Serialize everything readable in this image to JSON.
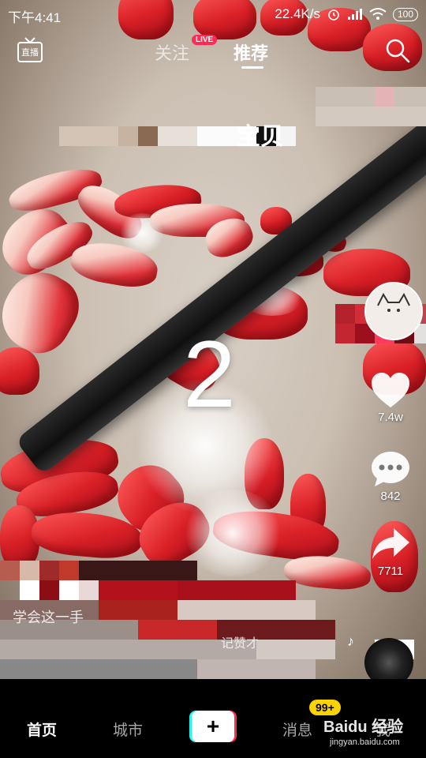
{
  "status_bar": {
    "time": "下午4:41",
    "network_speed": "22.4K/s",
    "battery": "100"
  },
  "top_nav": {
    "live_label": "直播",
    "tab_follow": "关注",
    "live_badge": "LIVE",
    "tab_recommend": "推荐"
  },
  "video": {
    "countdown": "2",
    "overlay_caption": "宝贝"
  },
  "actions": {
    "likes": "7.4w",
    "comments": "842",
    "shares": "7711"
  },
  "caption": {
    "line1": "学会这一手",
    "line2": "记赞才"
  },
  "bottom_nav": {
    "home": "首页",
    "city": "城市",
    "plus": "+",
    "messages": "消息",
    "messages_badge": "99+",
    "me": "我"
  },
  "watermark": {
    "logo": "Baidu 经验",
    "url": "jingyan.baidu.com"
  },
  "colors": {
    "accent": "#fe2c55",
    "cyan": "#25f4ee",
    "badge_yellow": "#fbd300"
  },
  "icons": [
    "live-tv-icon",
    "search-icon",
    "heart-icon",
    "comment-icon",
    "share-icon",
    "music-note-icon",
    "plus-icon"
  ]
}
